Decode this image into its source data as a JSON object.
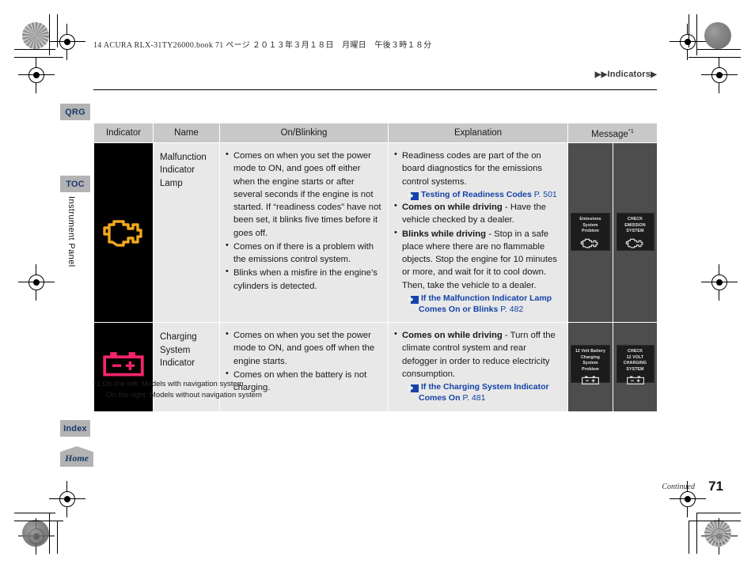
{
  "print_meta": "14 ACURA RLX-31TY26000.book  71 ページ  ２０１３年３月１８日　月曜日　午後３時１８分",
  "breadcrumb": {
    "tri_left": "▶▶",
    "label": "Indicators",
    "tri_right": "▶"
  },
  "tabs": {
    "qrg": "QRG",
    "toc": "TOC",
    "index": "Index",
    "home": "Home",
    "chapter": "Instrument Panel"
  },
  "table": {
    "headers": {
      "indicator": "Indicator",
      "name": "Name",
      "onblinking": "On/Blinking",
      "explanation": "Explanation",
      "message": "Message",
      "message_sup": "*1"
    },
    "rows": [
      {
        "name": "Malfunction\nIndicator Lamp",
        "icon": "engine-icon",
        "icon_color": "#F0A81E",
        "onblinking": [
          "Comes on when you set the power mode to ON, and goes off either when the engine starts or after several seconds if the engine is not started. If “readiness codes” have not been set, it blinks five times before it goes off.",
          "Comes on if there is a problem with the emissions control system.",
          "Blinks when a misfire in the engine’s cylinders is detected."
        ],
        "explanation": [
          {
            "bold": "",
            "text": "Readiness codes are part of the on board diagnostics for the emissions control systems.",
            "xref": {
              "title": "Testing of Readiness Codes",
              "page": "P. 501"
            }
          },
          {
            "bold": "Comes on while driving",
            "text": " - Have the vehicle checked by a dealer."
          },
          {
            "bold": "Blinks while driving",
            "text": " - Stop in a safe place where there are no flammable objects. Stop the engine for 10 minutes or more, and wait for it to cool down. Then, take the vehicle to a dealer.",
            "xref": {
              "title": "If the Malfunction Indicator Lamp Comes On or Blinks",
              "page": "P. 482"
            }
          }
        ],
        "message_left": {
          "lines": [
            "Emissions System",
            "Problem"
          ],
          "glyph": "engine-glyph"
        },
        "message_right": {
          "lines": [
            "CHECK",
            "EMISSION",
            "SYSTEM"
          ],
          "glyph": "engine-glyph"
        }
      },
      {
        "name": "Charging\nSystem\nIndicator",
        "icon": "battery-icon",
        "icon_color": "#F5246B",
        "onblinking": [
          "Comes on when you set the power mode to ON, and goes off when the engine starts.",
          "Comes on when the battery is not charging."
        ],
        "explanation": [
          {
            "bold": "Comes on while driving",
            "text": " - Turn off the climate control system and rear defogger in order to reduce electricity consumption.",
            "xref": {
              "title": "If the Charging System Indicator Comes On",
              "page": "P. 481"
            }
          }
        ],
        "message_left": {
          "lines": [
            "12 Volt Battery",
            "Charging System",
            "Problem"
          ],
          "glyph": "battery-glyph"
        },
        "message_right": {
          "lines": [
            "CHECK",
            "12 VOLT",
            "CHARGING",
            "SYSTEM"
          ],
          "glyph": "battery-glyph"
        }
      }
    ]
  },
  "footnote": {
    "line1": "*1:On the left: Models with navigation system",
    "line2": "On the right: Models without navigation system"
  },
  "footer": {
    "continued": "Continued",
    "page_number": "71"
  },
  "colors": {
    "header_bg": "#C8C8C8",
    "cell_bg": "#E8E8E8",
    "indicator_bg": "#000000",
    "message_bg": "#4D4D4D",
    "link": "#1442A8",
    "tab_bg": "#B3B3B3",
    "tab_text": "#1B3A6B"
  }
}
